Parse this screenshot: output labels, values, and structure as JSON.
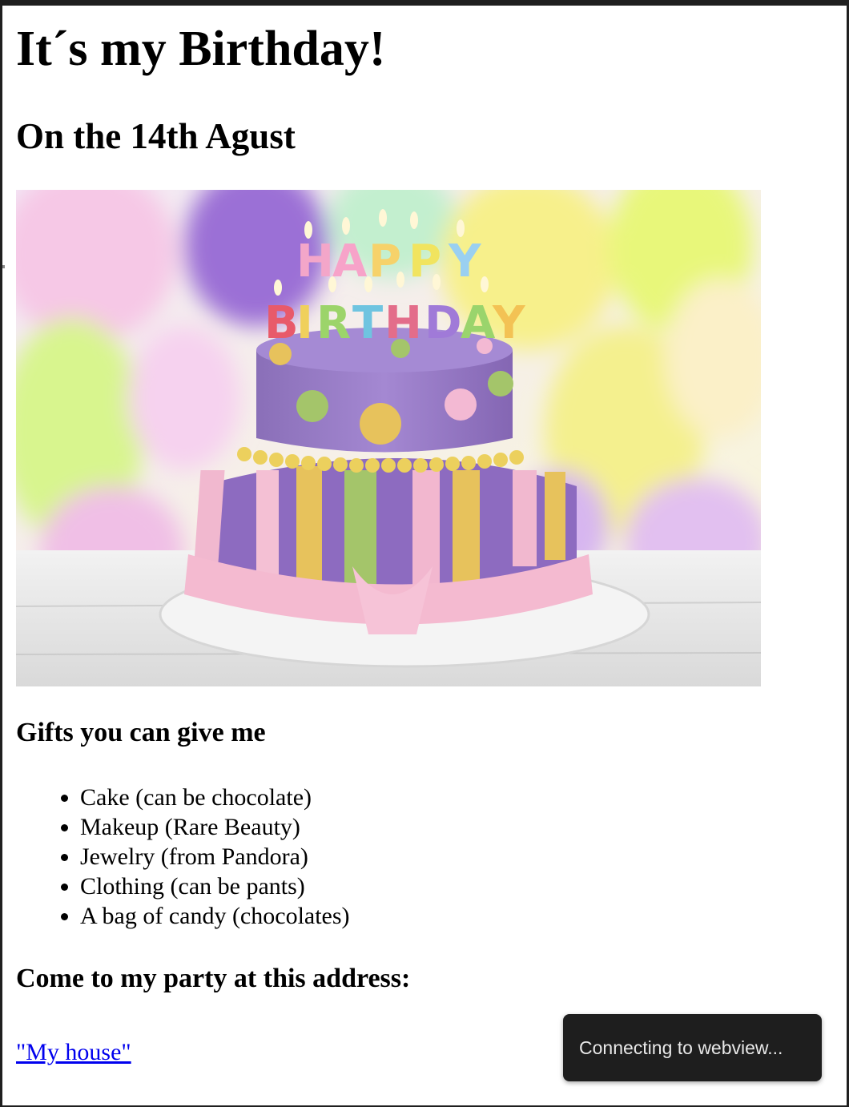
{
  "page": {
    "title": "It´s my Birthday!",
    "date_heading": "On the 14th Agust",
    "cake_image": {
      "alt": "Birthday cake",
      "candle_text_top": "HAPPY",
      "candle_text_bottom": "BIRTHDAY"
    },
    "gifts_heading": "Gifts you can give me",
    "gifts": [
      "Cake (can be chocolate)",
      "Makeup (Rare Beauty)",
      "Jewelry (from Pandora)",
      "Clothing (can be pants)",
      "A bag of candy (chocolates)"
    ],
    "address_heading": "Come to my party at this address:",
    "address_link": "\"My house\""
  },
  "toast": {
    "message": "Connecting to webview..."
  },
  "colors": {
    "link": "#0000ee",
    "toast_bg": "#1e1e1e",
    "frame": "#1f1f1f"
  }
}
